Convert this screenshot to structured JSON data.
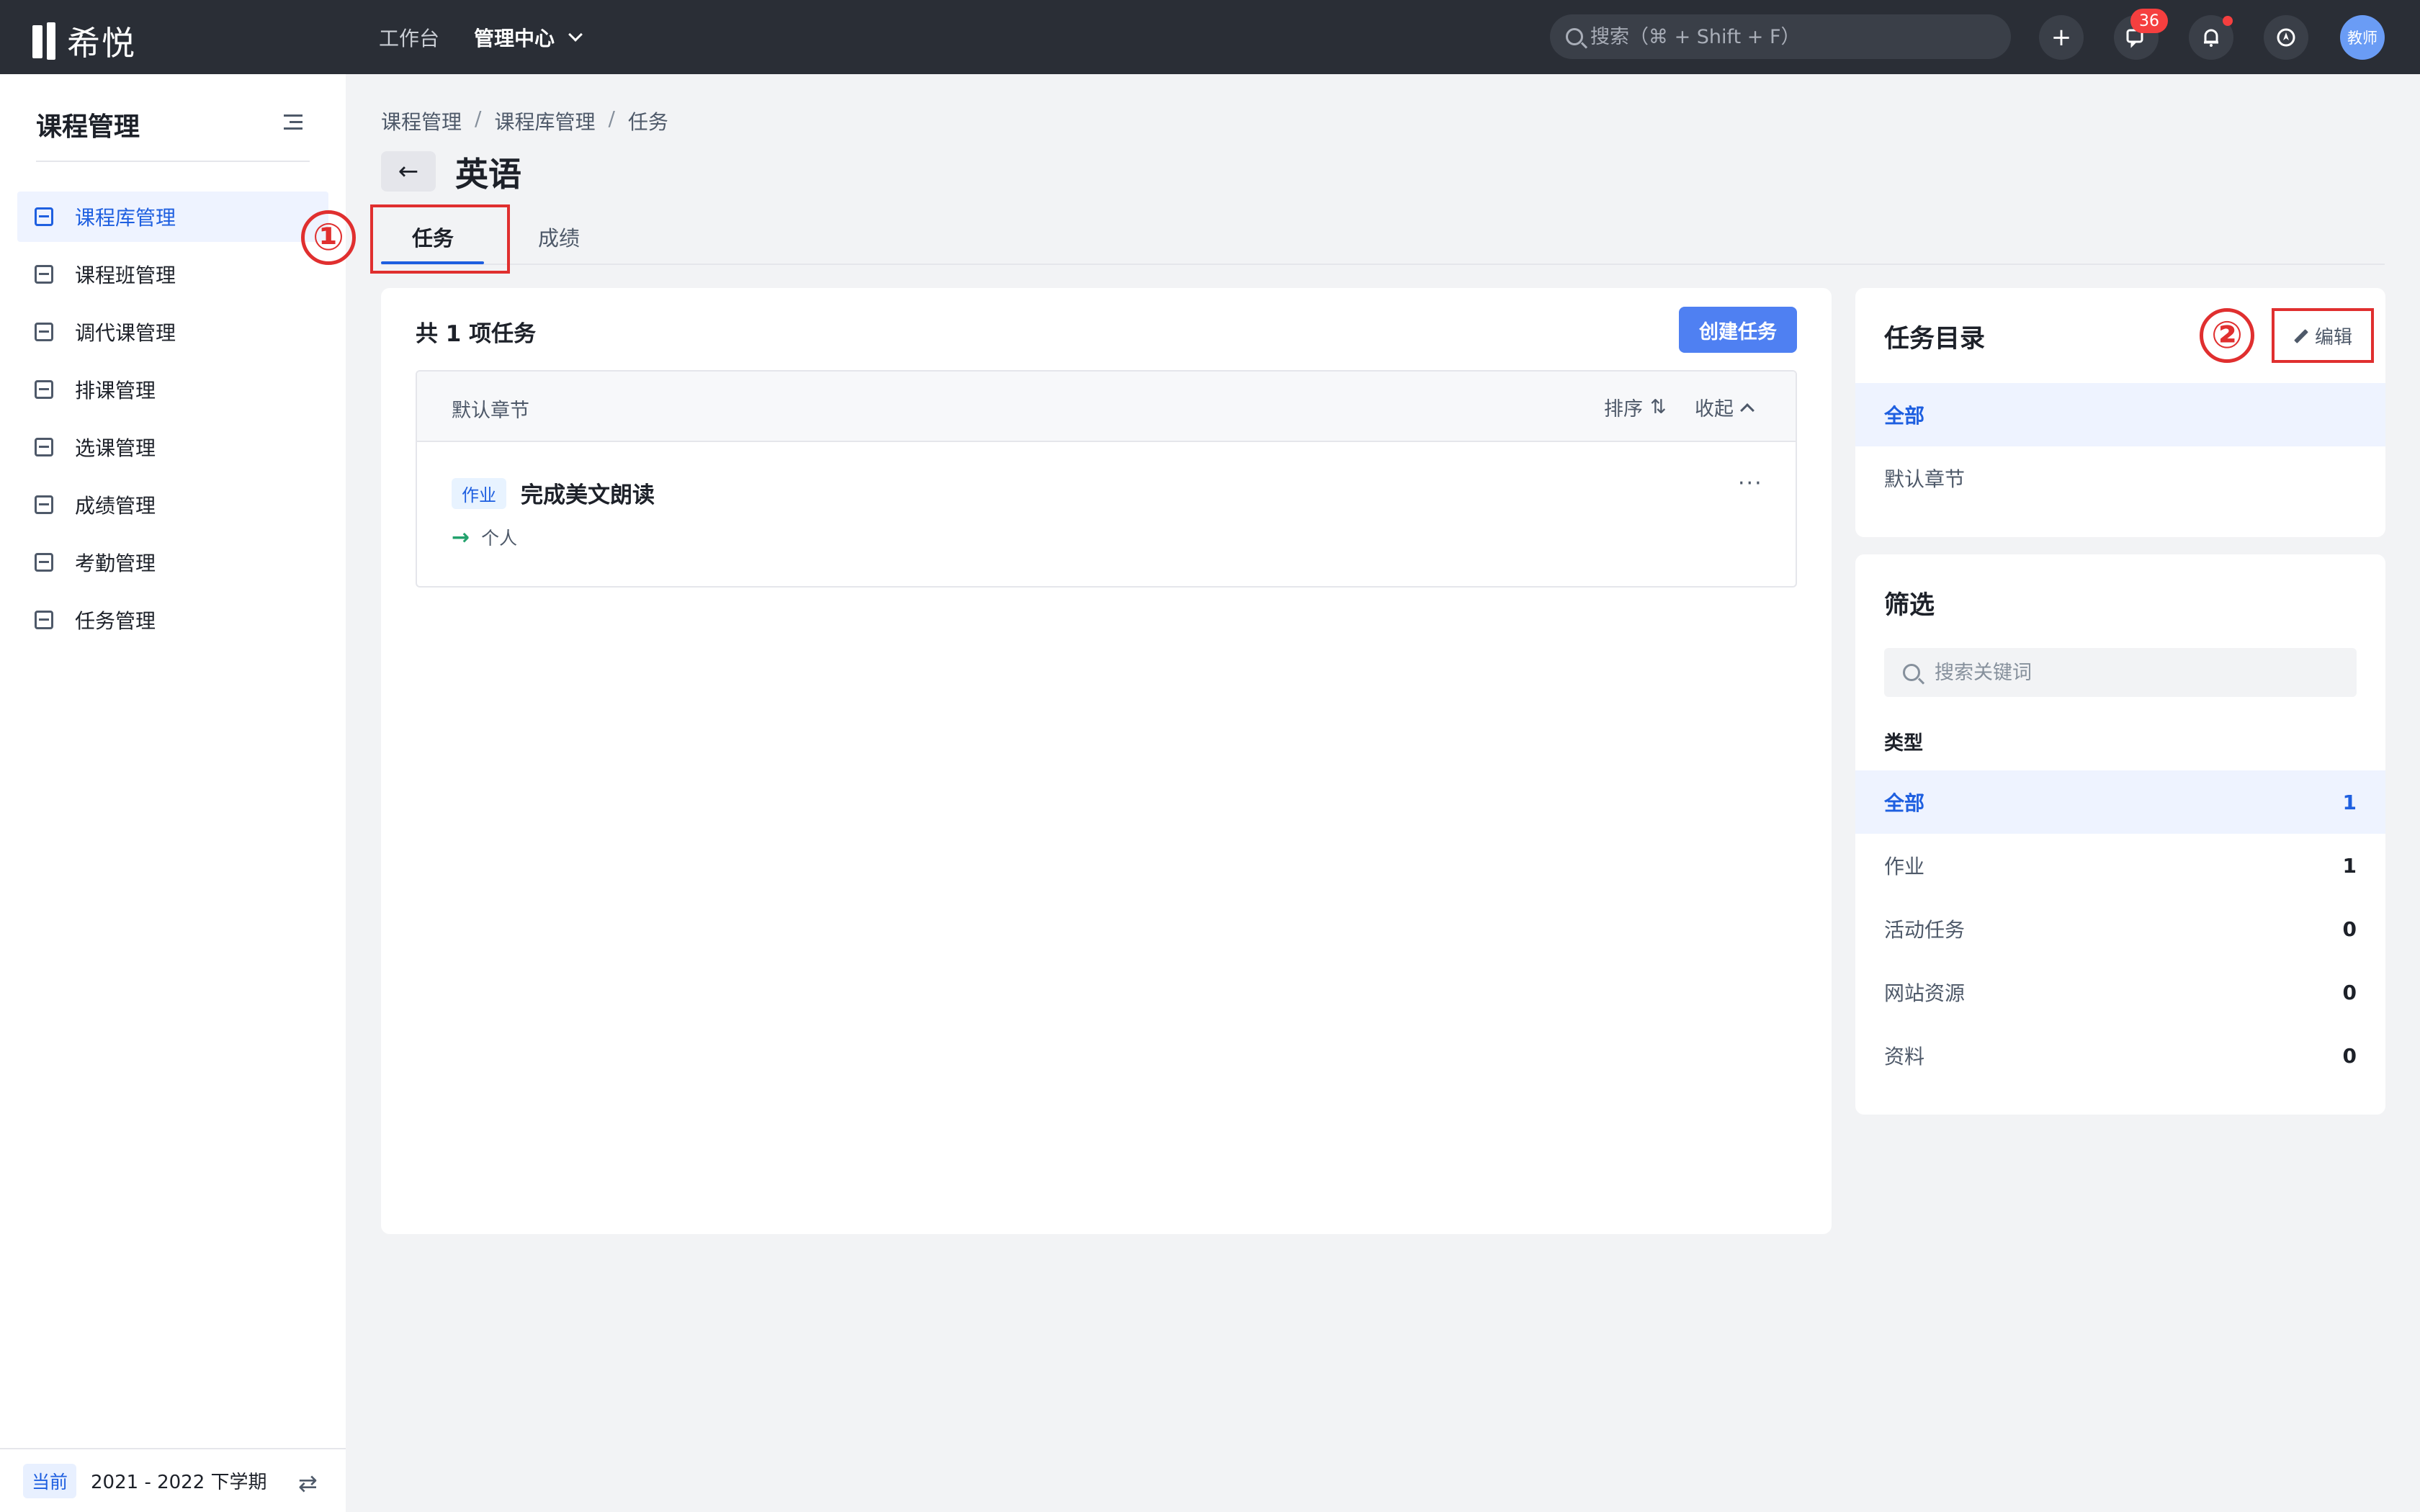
{
  "app": {
    "logo_text": "希悦"
  },
  "topnav": {
    "items": [
      "工作台"
    ],
    "active": "管理中心"
  },
  "search": {
    "placeholder": "搜索（⌘ + Shift + F）"
  },
  "header_icons": {
    "add": "+",
    "message_badge": "36",
    "avatar_text": "教师"
  },
  "sidebar": {
    "title": "课程管理",
    "items": [
      {
        "label": "课程库管理",
        "icon": "course-library-icon"
      },
      {
        "label": "课程班管理",
        "icon": "course-class-icon"
      },
      {
        "label": "调代课管理",
        "icon": "substitute-icon"
      },
      {
        "label": "排课管理",
        "icon": "schedule-icon"
      },
      {
        "label": "选课管理",
        "icon": "elective-icon"
      },
      {
        "label": "成绩管理",
        "icon": "grade-icon"
      },
      {
        "label": "考勤管理",
        "icon": "attendance-icon"
      },
      {
        "label": "任务管理",
        "icon": "task-icon"
      }
    ],
    "footer": {
      "tag": "当前",
      "term": "2021 - 2022 下学期"
    }
  },
  "breadcrumb": [
    "课程管理",
    "课程库管理",
    "任务"
  ],
  "page_title": "英语",
  "tabs": [
    "任务",
    "成绩"
  ],
  "annotations": [
    "①",
    "②"
  ],
  "task_panel": {
    "count_label": "共 1 项任务",
    "create_button": "创建任务",
    "chapter": {
      "name": "默认章节",
      "sort_label": "排序",
      "fold_label": "收起",
      "tasks": [
        {
          "type": "作业",
          "title": "完成美文朗读",
          "assignee": "个人"
        }
      ]
    }
  },
  "catalog": {
    "title": "任务目录",
    "edit_label": "编辑",
    "items": [
      "全部",
      "默认章节"
    ]
  },
  "filter": {
    "title": "筛选",
    "search_placeholder": "搜索关键词",
    "type_label": "类型",
    "types": [
      {
        "label": "全部",
        "count": "1"
      },
      {
        "label": "作业",
        "count": "1"
      },
      {
        "label": "活动任务",
        "count": "0"
      },
      {
        "label": "网站资源",
        "count": "0"
      },
      {
        "label": "资料",
        "count": "0"
      }
    ]
  },
  "colors": {
    "accent": "#1e5fe0",
    "topbar": "#2a2e36",
    "annotation": "#e02f2f"
  }
}
